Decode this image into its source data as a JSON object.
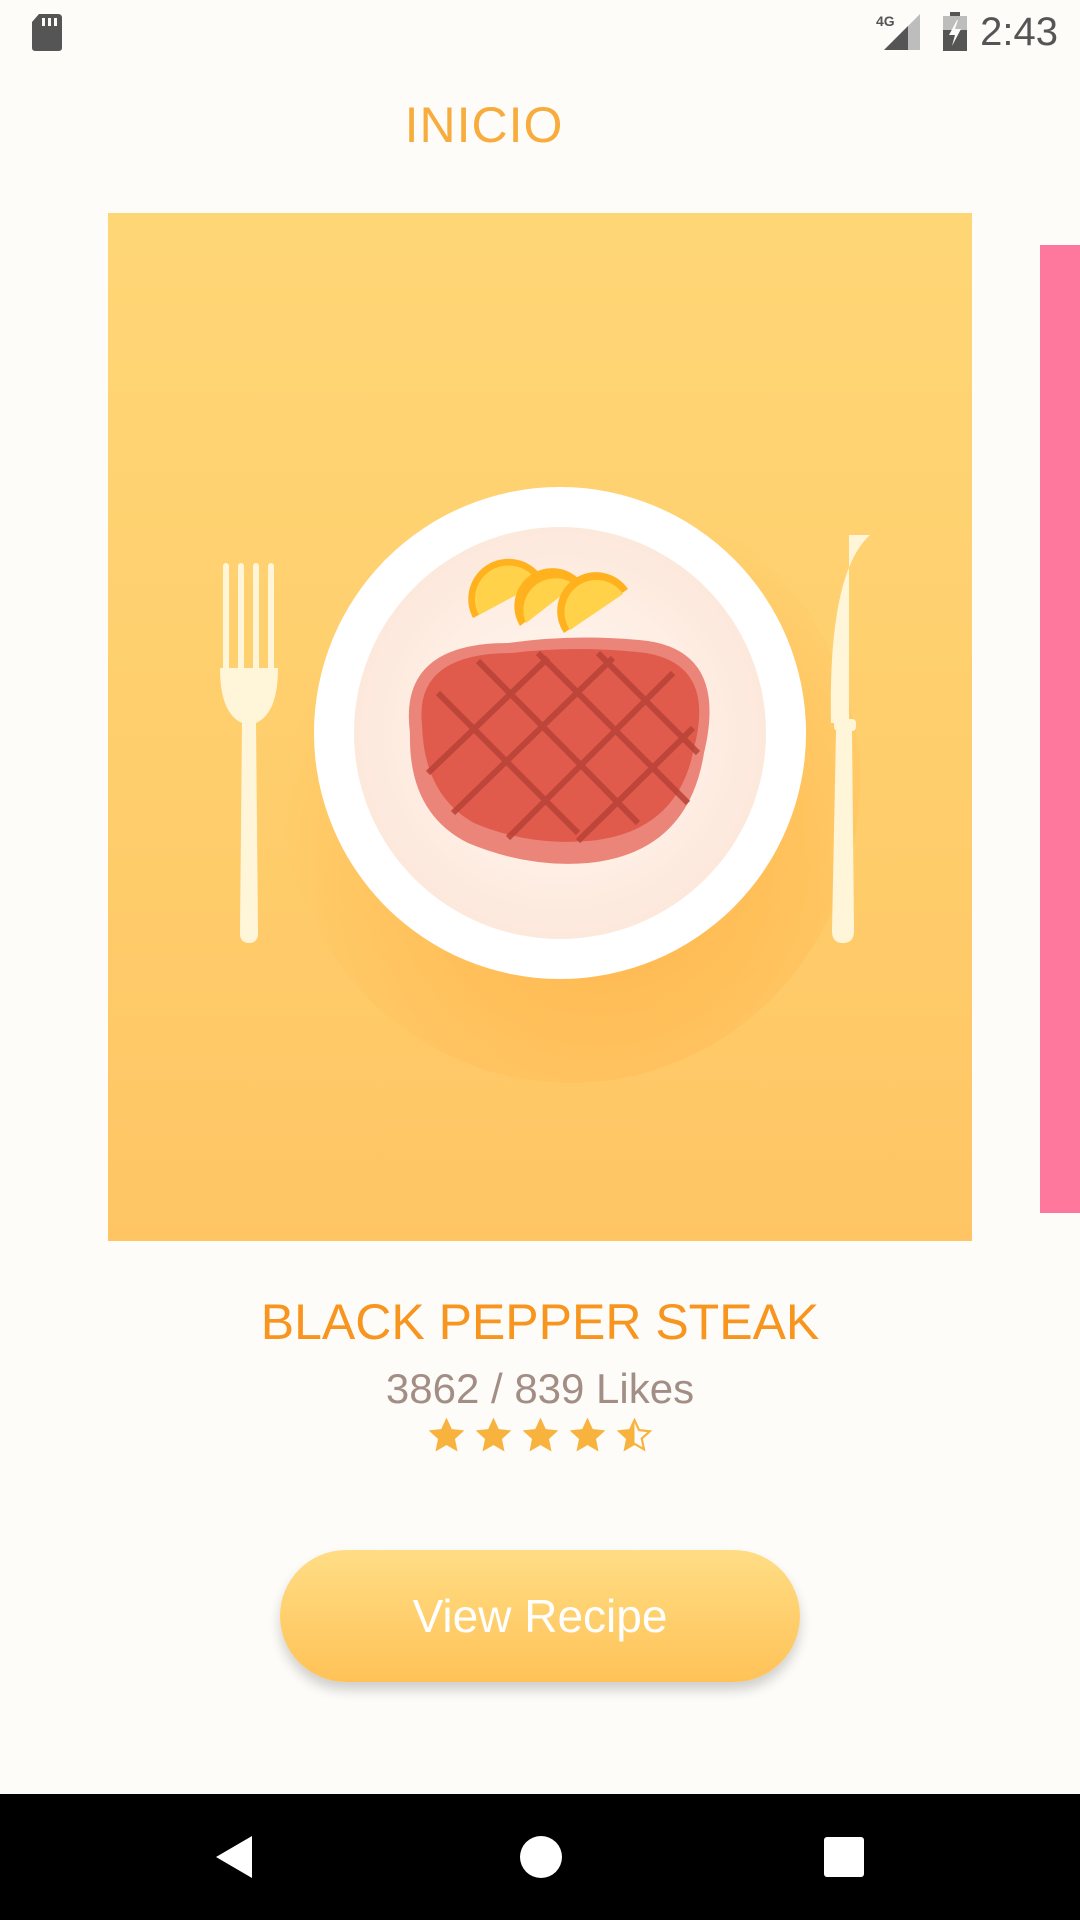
{
  "status_bar": {
    "network_label": "4G",
    "time": "2:43",
    "icons": [
      "sd-card-icon",
      "signal-icon",
      "battery-charging-icon"
    ]
  },
  "header": {
    "title": "INICIO"
  },
  "recipe": {
    "name": "BLACK PEPPER STEAK",
    "likes": "3862 / 839 Likes",
    "rating": 4.5,
    "rating_max": 5,
    "image_icon": "steak-plate-illustration",
    "button_label": "View Recipe"
  },
  "colors": {
    "accent_orange": "#f7951e",
    "title_orange": "#f7ac3d",
    "card_yellow": "#ffd676",
    "next_card_pink": "#fe789e",
    "star_color": "#f8b33e"
  },
  "nav_bar": {
    "icons": [
      "back-icon",
      "home-icon",
      "recents-icon"
    ]
  }
}
